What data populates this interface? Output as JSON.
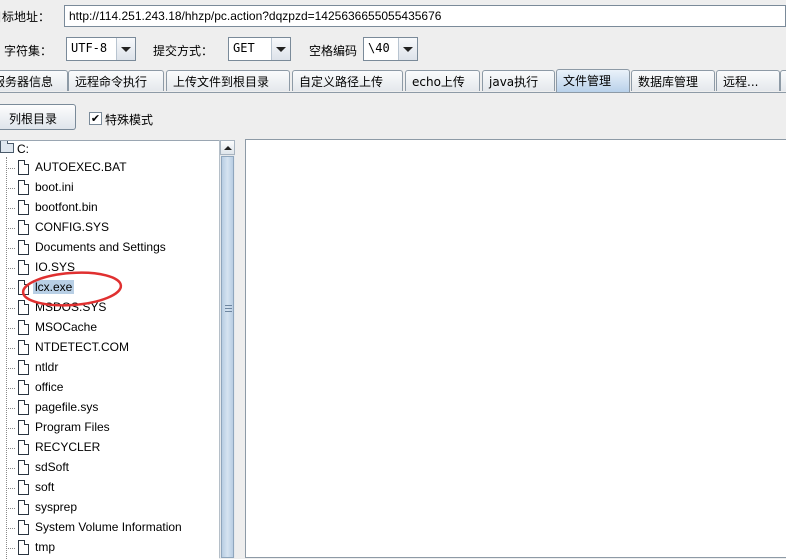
{
  "toolbar": {
    "target_label": "目标地址：",
    "url": "http://114.251.243.18/hhzp/pc.action?dqzpzd=1425636655055435676",
    "charset_label": "字符集：",
    "charset_value": "UTF-8",
    "method_label": "提交方式：",
    "method_value": "GET",
    "space_label": "空格编码",
    "space_value": "\\40"
  },
  "tabs": [
    {
      "label": "服务器信息"
    },
    {
      "label": "远程命令执行"
    },
    {
      "label": "上传文件到根目录"
    },
    {
      "label": "自定义路径上传"
    },
    {
      "label": "echo上传"
    },
    {
      "label": "java执行"
    },
    {
      "label": "文件管理",
      "active": true
    },
    {
      "label": "数据库管理"
    },
    {
      "label": "远程..."
    }
  ],
  "file_manager": {
    "list_root_button": "列根目录",
    "special_mode_label": "特殊模式",
    "special_mode_checked": "✔",
    "root_node": "C:",
    "selected_item": "lcx.exe",
    "items": [
      "AUTOEXEC.BAT",
      "boot.ini",
      "bootfont.bin",
      "CONFIG.SYS",
      "Documents and Settings",
      "IO.SYS",
      "lcx.exe",
      "MSDOS.SYS",
      "MSOCache",
      "NTDETECT.COM",
      "ntldr",
      "office",
      "pagefile.sys",
      "Program Files",
      "RECYCLER",
      "sdSoft",
      "soft",
      "sysprep",
      "System Volume Information",
      "tmp"
    ]
  },
  "colors": {
    "highlight_circle": "#e03030",
    "active_tab": "#b9d1ea",
    "selection": "#b8cfe5"
  }
}
